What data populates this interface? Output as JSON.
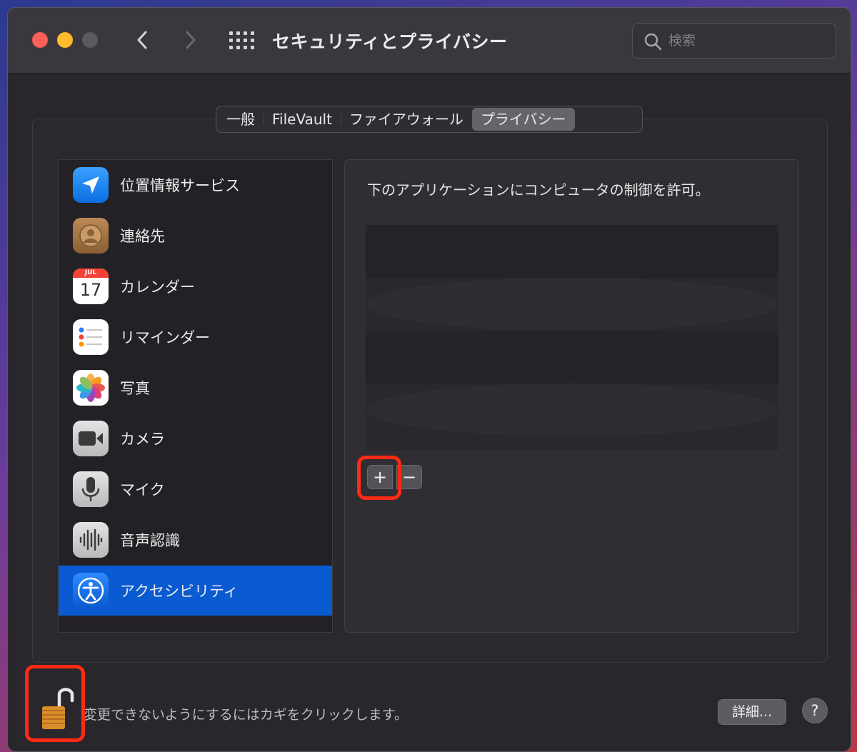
{
  "window": {
    "title": "セキュリティとプライバシー",
    "search_placeholder": "検索"
  },
  "tabs": [
    {
      "label": "一般",
      "selected": false
    },
    {
      "label": "FileVault",
      "selected": false
    },
    {
      "label": "ファイアウォール",
      "selected": false
    },
    {
      "label": "プライバシー",
      "selected": true
    }
  ],
  "sidebar": {
    "items": [
      {
        "label": "位置情報サービス",
        "icon": "location-arrow-icon",
        "selected": false
      },
      {
        "label": "連絡先",
        "icon": "contacts-icon",
        "selected": false
      },
      {
        "label": "カレンダー",
        "icon": "calendar-icon",
        "calendar_month": "JUL",
        "calendar_day": "17",
        "selected": false
      },
      {
        "label": "リマインダー",
        "icon": "reminders-icon",
        "selected": false
      },
      {
        "label": "写真",
        "icon": "photos-icon",
        "selected": false
      },
      {
        "label": "カメラ",
        "icon": "camera-icon",
        "selected": false
      },
      {
        "label": "マイク",
        "icon": "microphone-icon",
        "selected": false
      },
      {
        "label": "音声認識",
        "icon": "speech-recognition-icon",
        "selected": false
      },
      {
        "label": "アクセシビリティ",
        "icon": "accessibility-icon",
        "selected": true
      }
    ]
  },
  "main": {
    "description": "下のアプリケーションにコンピュータの制御を許可。",
    "add_label": "+",
    "remove_label": "−"
  },
  "footer": {
    "lock_text": "変更できないようにするにはカギをクリックします。",
    "advanced_label": "詳細...",
    "help_label": "?"
  },
  "colors": {
    "accent": "#0a5ad1",
    "highlight": "#ff2a14"
  }
}
